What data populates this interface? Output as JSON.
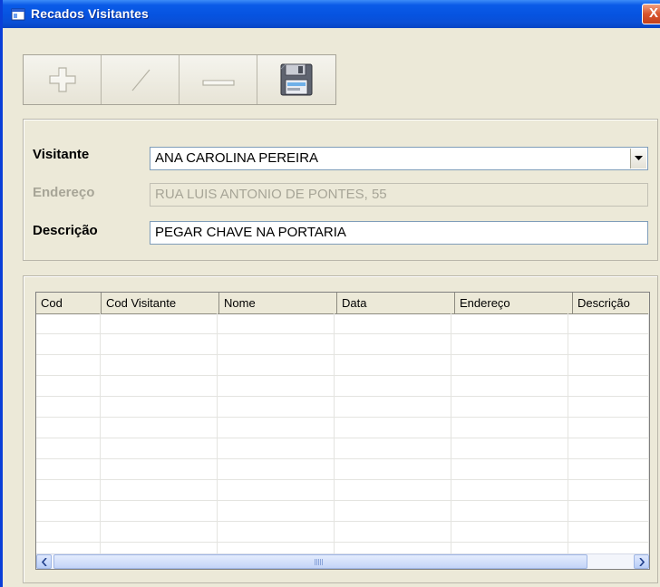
{
  "window": {
    "title": "Recados Visitantes",
    "close_label": "X"
  },
  "toolbar": {
    "buttons": [
      {
        "name": "add",
        "icon": "plus-icon",
        "enabled": false
      },
      {
        "name": "edit",
        "icon": "slash-icon",
        "enabled": false
      },
      {
        "name": "delete",
        "icon": "minus-icon",
        "enabled": false
      },
      {
        "name": "save",
        "icon": "floppy-disk-icon",
        "enabled": true
      }
    ]
  },
  "form": {
    "visitante_label": "Visitante",
    "visitante_value": "ANA CAROLINA PEREIRA",
    "endereco_label": "Endereço",
    "endereco_value": "RUA LUIS ANTONIO DE PONTES, 55",
    "descricao_label": "Descrição",
    "descricao_value": "PEGAR CHAVE NA PORTARIA"
  },
  "grid": {
    "columns": [
      "Cod",
      "Cod Visitante",
      "Nome",
      "Data",
      "Endereço",
      "Descrição"
    ],
    "rows": []
  },
  "colors": {
    "titlebar": "#0653e0",
    "window_face": "#ece9d8",
    "close_button": "#d8542c"
  }
}
